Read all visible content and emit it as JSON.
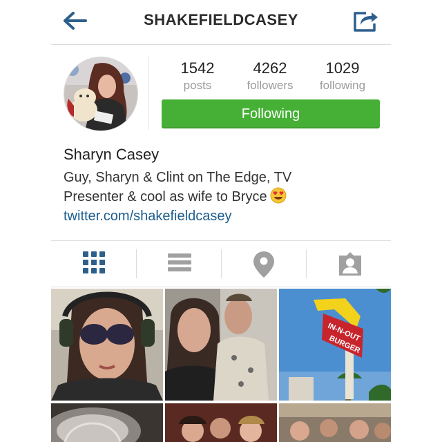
{
  "header": {
    "username": "SHAKEFIELDCASEY",
    "back_icon": "back-arrow-icon",
    "share_icon": "share-icon"
  },
  "stats": {
    "posts": {
      "count": "1542",
      "label": "posts"
    },
    "followers": {
      "count": "4262",
      "label": "followers"
    },
    "following": {
      "count": "1029",
      "label": "following"
    }
  },
  "follow_button": {
    "label": "Following",
    "color": "#45b035"
  },
  "profile": {
    "name": "Sharyn Casey",
    "bio_line1": "Guy, Sharyn & Clint on The Edge, TV",
    "bio_line2": "Presenter & cool as wife to Bryce",
    "bio_emoji": "heart-eyes-emoji",
    "link": "twitter.com/shakefieldcasey"
  },
  "tabs": [
    {
      "name": "grid-view",
      "icon": "grid-icon",
      "active": true
    },
    {
      "name": "list-view",
      "icon": "list-icon",
      "active": false
    },
    {
      "name": "map-view",
      "icon": "location-pin-icon",
      "active": false
    },
    {
      "name": "tagged-photos",
      "icon": "tagged-person-icon",
      "active": false
    }
  ],
  "colors": {
    "accent_blue": "#1c5e8e",
    "green": "#45b035",
    "tab_active": "#2d5f8c",
    "tab_inactive": "#a0a0a0"
  },
  "photos": [
    {
      "name": "photo-selfie-sunglasses-headset"
    },
    {
      "name": "photo-couple-selfie"
    },
    {
      "name": "photo-in-n-out-burger-sign",
      "sign_text_1": "IN-N-OUT",
      "sign_text_2": "BURGER"
    },
    {
      "name": "photo-chandelier"
    },
    {
      "name": "photo-group-party"
    },
    {
      "name": "photo-crowd"
    }
  ]
}
